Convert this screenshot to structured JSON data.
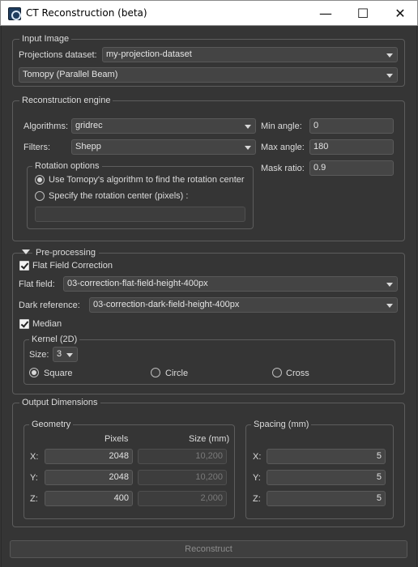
{
  "window": {
    "title": "CT Reconstruction (beta)",
    "minimize_glyph": "—",
    "maximize_glyph": "☐",
    "close_glyph": "✕"
  },
  "input_image": {
    "title": "Input Image",
    "dataset_label": "Projections dataset:",
    "dataset_value": "my-projection-dataset",
    "geometry_value": "Tomopy (Parallel Beam)"
  },
  "engine": {
    "title": "Reconstruction engine",
    "algorithms_label": "Algorithms:",
    "algorithms_value": "gridrec",
    "filters_label": "Filters:",
    "filters_value": "Shepp",
    "min_angle_label": "Min angle:",
    "min_angle_value": "0",
    "max_angle_label": "Max angle:",
    "max_angle_value": "180",
    "mask_ratio_label": "Mask ratio:",
    "mask_ratio_value": "0.9",
    "rotation": {
      "title": "Rotation options",
      "option_auto": "Use Tomopy's algorithm to find the rotation center",
      "option_manual": "Specify the rotation center (pixels) :",
      "center_value": ""
    }
  },
  "preprocessing": {
    "title": "Pre-processing",
    "flat_field_label": "Flat Field Correction",
    "flat_field_checked": true,
    "flat_label": "Flat field:",
    "flat_value": "03-correction-flat-field-height-400px",
    "dark_label": "Dark reference:",
    "dark_value": "03-correction-dark-field-height-400px",
    "median_label": "Median",
    "median_checked": true,
    "kernel": {
      "title": "Kernel (2D)",
      "size_label": "Size:",
      "size_value": "3",
      "square": "Square",
      "circle": "Circle",
      "cross": "Cross"
    }
  },
  "output": {
    "title": "Output Dimensions",
    "geometry": {
      "title": "Geometry",
      "col_pixels": "Pixels",
      "col_size": "Size (mm)",
      "x_label": "X:",
      "y_label": "Y:",
      "z_label": "Z:",
      "x_pixels": "2048",
      "y_pixels": "2048",
      "z_pixels": "400",
      "x_size": "10,200",
      "y_size": "10,200",
      "z_size": "2,000"
    },
    "spacing": {
      "title": "Spacing (mm)",
      "x_label": "X:",
      "y_label": "Y:",
      "z_label": "Z:",
      "x_value": "5",
      "y_value": "5",
      "z_value": "5"
    }
  },
  "reconstruct_label": "Reconstruct"
}
